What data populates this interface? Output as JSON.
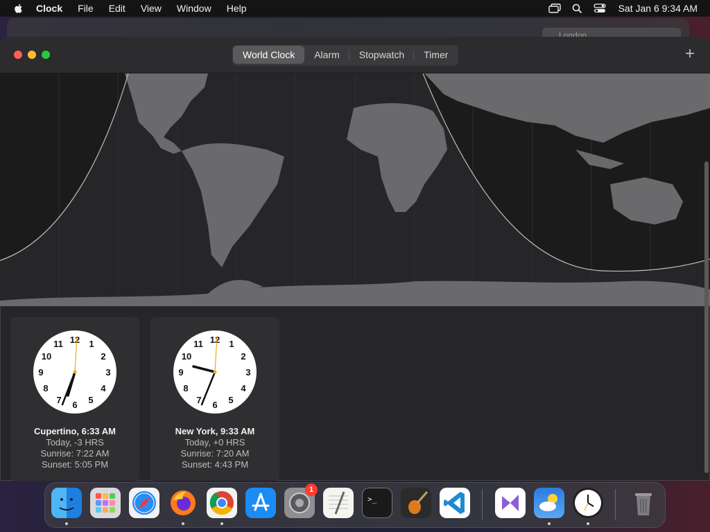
{
  "menubar": {
    "items": [
      "Clock",
      "File",
      "Edit",
      "View",
      "Window",
      "Help"
    ],
    "datetime": "Sat Jan 6  9:34 AM"
  },
  "background_window": {
    "search_text": "London"
  },
  "toolbar": {
    "tabs": [
      "World Clock",
      "Alarm",
      "Stopwatch",
      "Timer"
    ],
    "active_tab": "World Clock",
    "add_label": "+"
  },
  "clocks": [
    {
      "city": "Cupertino, 6:33 AM",
      "offset": "Today, -3 HRS",
      "sunrise": "Sunrise: 7:22 AM",
      "sunset": "Sunset: 5:05 PM"
    },
    {
      "city": "New York, 9:33 AM",
      "offset": "Today, +0 HRS",
      "sunrise": "Sunrise: 7:20 AM",
      "sunset": "Sunset: 4:43 PM"
    }
  ],
  "dock": {
    "apps": [
      "Finder",
      "Launchpad",
      "Safari",
      "Firefox",
      "Chrome",
      "App Store",
      "System Settings",
      "TextEdit",
      "Terminal",
      "GarageBand",
      "Visual Studio Code",
      "Visual Studio",
      "Weather",
      "Clock",
      "Trash"
    ],
    "system_settings_badge": "1"
  },
  "colors": {
    "accent": "#f5a623",
    "close": "#ff5f57",
    "minimize": "#febc2e",
    "zoom": "#28c840"
  }
}
